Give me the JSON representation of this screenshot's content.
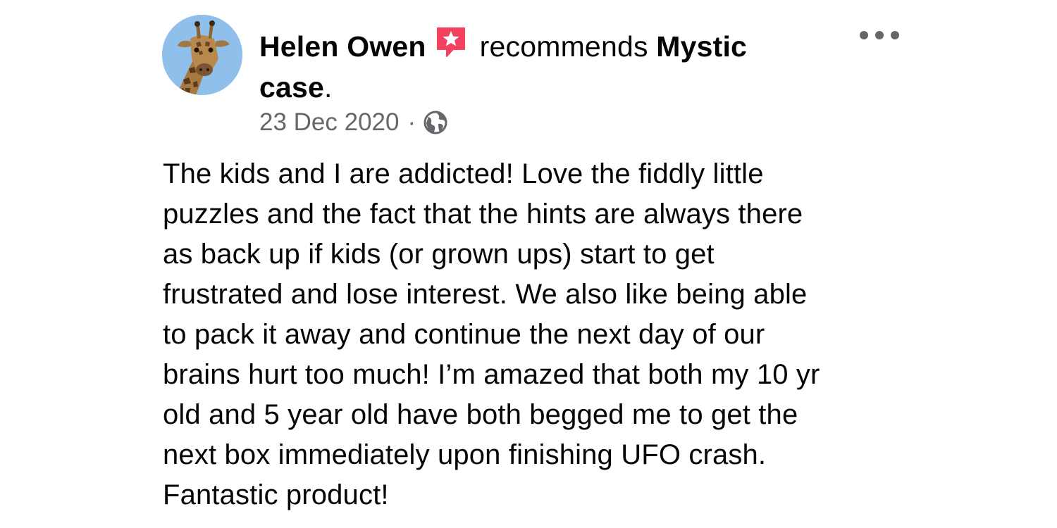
{
  "post": {
    "author": "Helen Owen",
    "verb": "recommends",
    "page_name": "Mystic",
    "page_name_cont": "case",
    "page_name_end": ".",
    "date": "23 Dec 2020",
    "separator": "·",
    "privacy_icon": "globe-icon",
    "recommend_icon": "recommend-star-icon",
    "more_icon": "more-options-icon",
    "body": "The kids and I are addicted! Love the fiddly little\npuzzles and the fact that the hints are always there\nas back up if kids (or grown ups) start to get\nfrustrated and lose interest. We also like being able\nto pack it away and continue the next day of our\nbrains hurt too much! I’m amazed that both my 10 yr\nold and 5 year old have both begged me to get the\nnext box immediately upon finishing UFO crash.\nFantastic product!"
  },
  "colors": {
    "recommend_accent": "#f3425f",
    "secondary_text": "#65676b",
    "primary_text": "#050505",
    "avatar_sky": "#8fc0ec"
  }
}
